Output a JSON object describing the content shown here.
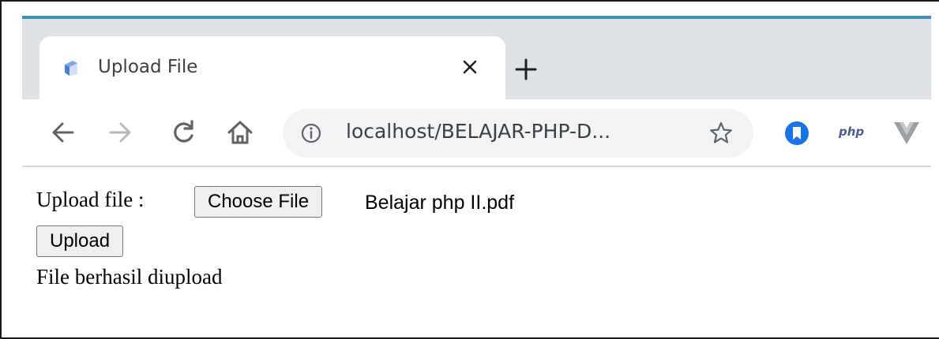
{
  "browser": {
    "tab": {
      "title": "Upload File"
    },
    "address_bar": {
      "url": "localhost/BELAJAR-PHP-D..."
    },
    "extensions": [
      {
        "name": "bookmark-extension-icon"
      },
      {
        "name": "php-extension-icon",
        "label": "php"
      },
      {
        "name": "vue-extension-icon"
      }
    ],
    "accent_color": "#3a8fb7"
  },
  "page": {
    "upload_label": "Upload file :",
    "choose_file_label": "Choose File",
    "selected_file": "Belajar php II.pdf",
    "upload_button_label": "Upload",
    "status_message": "File berhasil diupload"
  }
}
